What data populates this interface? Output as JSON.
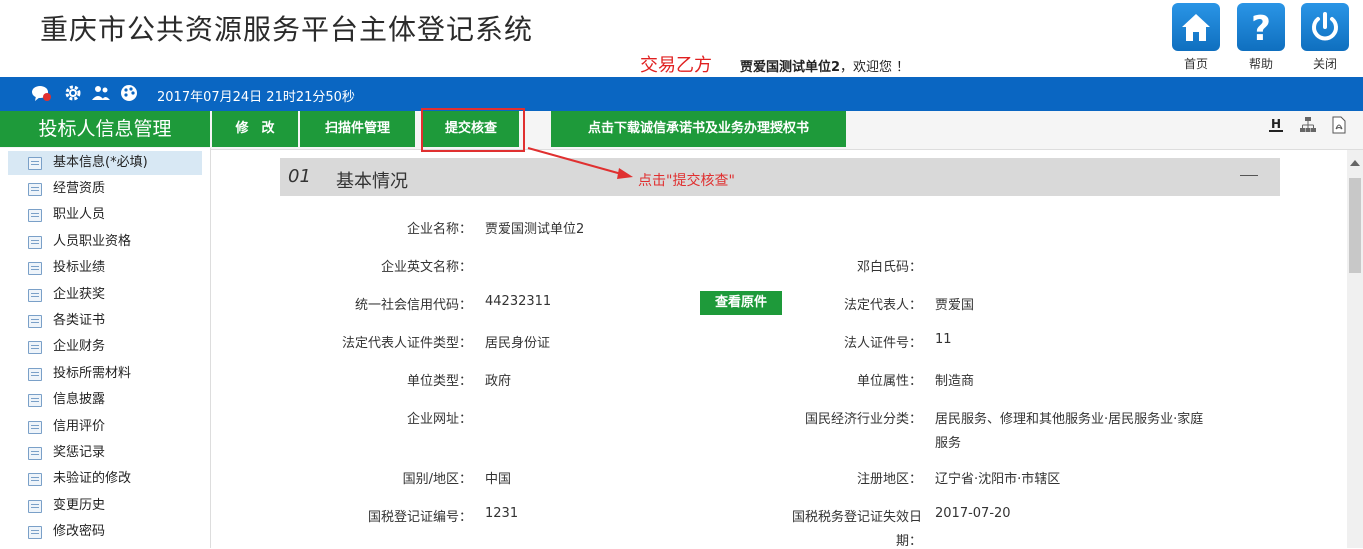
{
  "header": {
    "title": "重庆市公共资源服务平台主体登记系统",
    "role": "交易乙方",
    "user": "贾爱国测试单位2",
    "welcome": "，欢迎您 ！",
    "buttons": [
      {
        "label": "首页",
        "icon": "home-icon"
      },
      {
        "label": "帮助",
        "icon": "help-icon"
      },
      {
        "label": "关闭",
        "icon": "power-icon"
      }
    ]
  },
  "bluebar": {
    "datetime": "2017年07月24日 21时21分50秒",
    "icons": [
      "message-icon",
      "gear-icon",
      "users-icon",
      "palette-icon"
    ]
  },
  "menubar": {
    "section_title": "投标人信息管理",
    "buttons": [
      "修　改",
      "扫描件管理",
      "提交核查",
      "点击下载诚信承诺书及业务办理授权书"
    ],
    "tool_icons": [
      "history-icon",
      "org-chart-icon",
      "pdf-icon"
    ]
  },
  "sidebar": {
    "items": [
      "基本信息(*必填)",
      "经营资质",
      "职业人员",
      "人员职业资格",
      "投标业绩",
      "企业获奖",
      "各类证书",
      "企业财务",
      "投标所需材料",
      "信息披露",
      "信用评价",
      "奖惩记录",
      "未验证的修改",
      "变更历史",
      "修改密码"
    ]
  },
  "section": {
    "num": "01",
    "title": "基本情况",
    "collapse": "—"
  },
  "annotation": "点击\"提交核查\"",
  "view_original": "查看原件",
  "fields": {
    "company_name": {
      "label": "企业名称：",
      "value": "贾爱国测试单位2"
    },
    "company_en_name": {
      "label": "企业英文名称：",
      "value": ""
    },
    "duns": {
      "label": "邓白氏码：",
      "value": ""
    },
    "credit_code": {
      "label": "统一社会信用代码：",
      "value": "44232311"
    },
    "legal_rep": {
      "label": "法定代表人：",
      "value": "贾爱国"
    },
    "legal_id_type": {
      "label": "法定代表人证件类型：",
      "value": "居民身份证"
    },
    "legal_id_no": {
      "label": "法人证件号：",
      "value": "11"
    },
    "unit_type": {
      "label": "单位类型：",
      "value": "政府"
    },
    "unit_attr": {
      "label": "单位属性：",
      "value": "制造商"
    },
    "website": {
      "label": "企业网址：",
      "value": ""
    },
    "industry": {
      "label": "国民经济行业分类：",
      "value_line1": "居民服务、修理和其他服务业·居民服务业·家庭",
      "value_line2": "服务"
    },
    "country": {
      "label": "国别/地区：",
      "value": "中国"
    },
    "reg_area": {
      "label": "注册地区：",
      "value": "辽宁省·沈阳市·市辖区"
    },
    "tax_no": {
      "label": "国税登记证编号：",
      "value": "1231"
    },
    "tax_expiry": {
      "label_line1": "国税税务登记证失效日",
      "label_line2": "期：",
      "value": "2017-07-20"
    }
  }
}
